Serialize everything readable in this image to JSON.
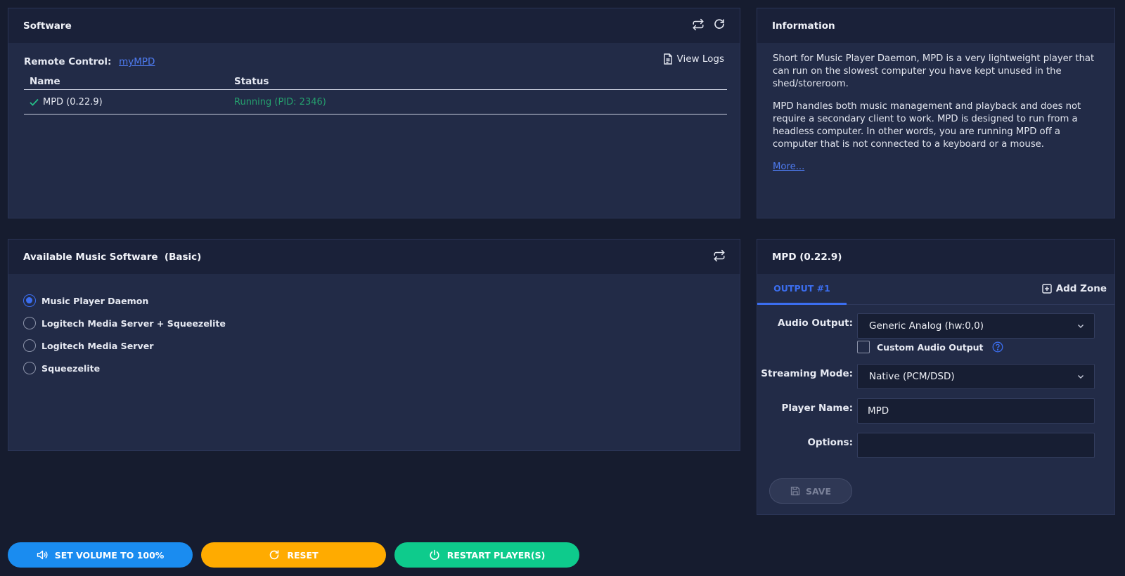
{
  "software": {
    "title": "Software",
    "remote_label": "Remote Control:",
    "remote_link": "myMPD",
    "view_logs": "View Logs",
    "columns": [
      "Name",
      "Status"
    ],
    "rows": [
      {
        "name": "MPD (0.22.9)",
        "status": "Running (PID: 2346)"
      }
    ],
    "icons": [
      "swap-icon",
      "refresh-icon",
      "file-icon",
      "check-icon"
    ]
  },
  "info": {
    "title": "Information",
    "p1": "Short for Music Player Daemon, MPD is a very lightweight player that can run on the slowest computer you have kept unused in the shed/storeroom.",
    "p2": "MPD handles both music management and playback and does not require a secondary client to work. MPD is designed to run from a headless computer. In other words, you are running MPD off a computer that is not connected to a keyboard or a mouse.",
    "more": "More..."
  },
  "available": {
    "title": "Available Music Software  (Basic)",
    "options": [
      {
        "label": "Music Player Daemon",
        "selected": true
      },
      {
        "label": "Logitech Media Server + Squeezelite",
        "selected": false
      },
      {
        "label": "Logitech Media Server",
        "selected": false
      },
      {
        "label": "Squeezelite",
        "selected": false
      }
    ]
  },
  "mpd": {
    "title": "MPD (0.22.9)",
    "tab": "OUTPUT #1",
    "add_zone": "Add Zone",
    "audio_output_label": "Audio Output:",
    "audio_output_value": "Generic Analog (hw:0,0)",
    "custom_output_label": "Custom Audio Output",
    "streaming_label": "Streaming Mode:",
    "streaming_value": "Native (PCM/DSD)",
    "player_name_label": "Player Name:",
    "player_name_value": "MPD",
    "options_label": "Options:",
    "options_value": "",
    "save": "SAVE"
  },
  "actions": {
    "volume": "SET VOLUME TO 100%",
    "reset": "RESET",
    "restart": "RESTART PLAYER(S)"
  },
  "colors": {
    "accent": "#3b6ef0",
    "running": "#25a06e",
    "volume_btn": "#1a8cf0",
    "reset_btn": "#ffab00",
    "restart_btn": "#0ecb8c"
  }
}
